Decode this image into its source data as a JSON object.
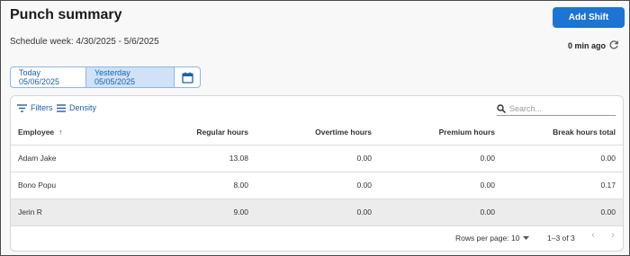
{
  "header": {
    "title": "Punch summary",
    "add_shift_label": "Add Shift",
    "schedule_week": "Schedule week: 4/30/2025 - 5/6/2025",
    "updated_label": "0 min ago"
  },
  "date_toggle": {
    "today_label": "Today 05/06/2025",
    "yesterday_label": "Yesterday 05/05/2025",
    "selected": "yesterday"
  },
  "toolbar": {
    "filters_label": "Filters",
    "density_label": "Density",
    "search_placeholder": "Search..."
  },
  "table": {
    "columns": [
      "Employee",
      "Regular hours",
      "Overtime hours",
      "Premium hours",
      "Break hours total"
    ],
    "sort_column": "Employee",
    "sort_direction": "asc",
    "rows": [
      {
        "employee": "Adam Jake",
        "regular": "13.08",
        "overtime": "0.00",
        "premium": "0.00",
        "break": "0.00"
      },
      {
        "employee": "Bono Popu",
        "regular": "8.00",
        "overtime": "0.00",
        "premium": "0.00",
        "break": "0.17"
      },
      {
        "employee": "Jerin R",
        "regular": "9.00",
        "overtime": "0.00",
        "premium": "0.00",
        "break": "0.00"
      }
    ]
  },
  "pagination": {
    "rows_per_page_label": "Rows per page:",
    "rows_per_page_value": "10",
    "range_label": "1–3 of 3"
  },
  "colors": {
    "accent": "#1c74d4",
    "selected_date_bg": "#cfe2f7",
    "hovered_row_bg": "#ececec"
  },
  "icons": {
    "refresh": "refresh-icon",
    "calendar": "calendar-icon",
    "filter": "filter-icon",
    "density": "density-icon",
    "search": "search-icon",
    "sort": "arrow-up-icon",
    "dropdown": "caret-down-icon",
    "prev": "chevron-left-icon",
    "next": "chevron-right-icon"
  }
}
